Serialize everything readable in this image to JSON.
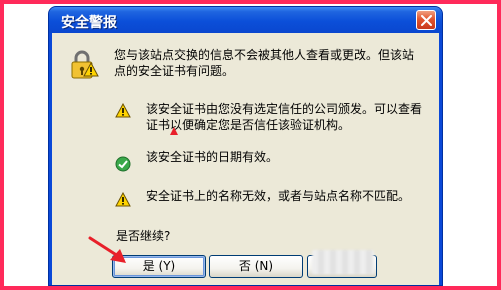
{
  "window": {
    "title": "安全警报"
  },
  "intro_text": "您与该站点交换的信息不会被其他人查看或更改。但该站点的安全证书有问题。",
  "items": [
    {
      "icon": "warning-icon",
      "text": "该安全证书由您没有选定信任的公司颁发。可以查看证书以便确定您是否信任该验证机构。"
    },
    {
      "icon": "check-icon",
      "text": "该安全证书的日期有效。"
    },
    {
      "icon": "warning-icon",
      "text": "安全证书上的名称无效，或者与站点名称不匹配。"
    }
  ],
  "prompt": "是否继续?",
  "buttons": {
    "yes_label": "是 (Y)",
    "no_label": "否 (N)"
  },
  "colors": {
    "titlebar": "#0b4fd9",
    "dialog_bg": "#ece9d8",
    "frame": "#ff2a5a",
    "annotation": "#e8202a"
  }
}
